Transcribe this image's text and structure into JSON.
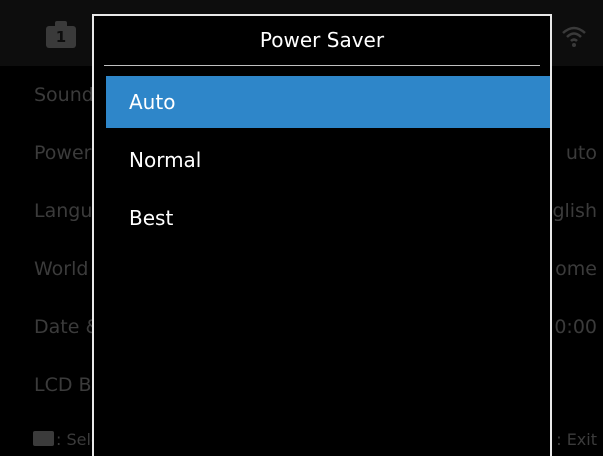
{
  "background_menu": {
    "tab_number": "1",
    "tab_icon": "camera-tab-icon",
    "wifi_icon": "wifi-icon",
    "rows": [
      {
        "label": "Sound",
        "value": ""
      },
      {
        "label": "Power",
        "value": "uto"
      },
      {
        "label": "Langu",
        "value": "glish"
      },
      {
        "label": "World",
        "value": "ome"
      },
      {
        "label": "Date &",
        "value": "0:00"
      },
      {
        "label": "LCD Br",
        "value": ""
      }
    ],
    "footer": {
      "nav_icon": "dpad-icon",
      "left_text": ": Sele",
      "right_text": ": Exit"
    }
  },
  "dialog": {
    "title": "Power Saver",
    "options": [
      "Auto",
      "Normal",
      "Best"
    ],
    "selected_index": 0,
    "colors": {
      "highlight": "#2e86c9",
      "border": "#e8e8e8"
    }
  }
}
